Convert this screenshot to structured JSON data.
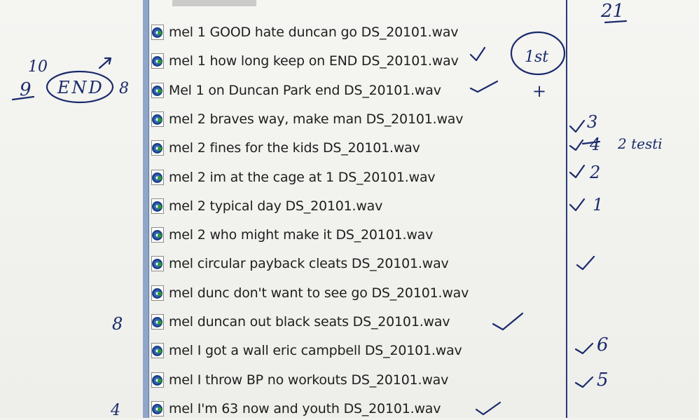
{
  "files": [
    {
      "name": "mel 1 GOOD hate duncan go DS_20101.wav"
    },
    {
      "name": "mel 1 how long keep on END DS_20101.wav"
    },
    {
      "name": "Mel 1 on Duncan Park end DS_20101.wav"
    },
    {
      "name": "mel 2 braves way, make man DS_20101.wav"
    },
    {
      "name": "mel 2 fines for the kids DS_20101.wav"
    },
    {
      "name": "mel 2 im at the cage at 1 DS_20101.wav"
    },
    {
      "name": "mel 2 typical day DS_20101.wav"
    },
    {
      "name": "mel 2 who might make it DS_20101.wav"
    },
    {
      "name": "mel circular payback cleats DS_20101.wav"
    },
    {
      "name": "mel dunc don't want to see go DS_20101.wav"
    },
    {
      "name": "mel duncan out black seats DS_20101.wav"
    },
    {
      "name": "mel I got a wall eric campbell DS_20101.wav"
    },
    {
      "name": "mel I throw BP no workouts DS_20101.wav"
    },
    {
      "name": "mel I'm 63 now and youth DS_20101.wav"
    }
  ],
  "file_icon": "audio-file-icon",
  "annotations": {
    "page_number": "21",
    "left_ten": "10",
    "left_nine": "9",
    "end_circle": "END",
    "left_eight_top": "8",
    "first_circle": "1st",
    "first_mark": "+",
    "rank_three": "3",
    "rank_four": "4",
    "testing_note": "2 testi",
    "rank_two": "2",
    "rank_one": "1",
    "left_eight_bottom": "8",
    "rank_six": "6",
    "rank_five": "5",
    "left_four": "4"
  },
  "colors": {
    "ink": "#1a2a6c",
    "paper": "#f2f2ef",
    "list_strip": "#8fa6c9"
  }
}
